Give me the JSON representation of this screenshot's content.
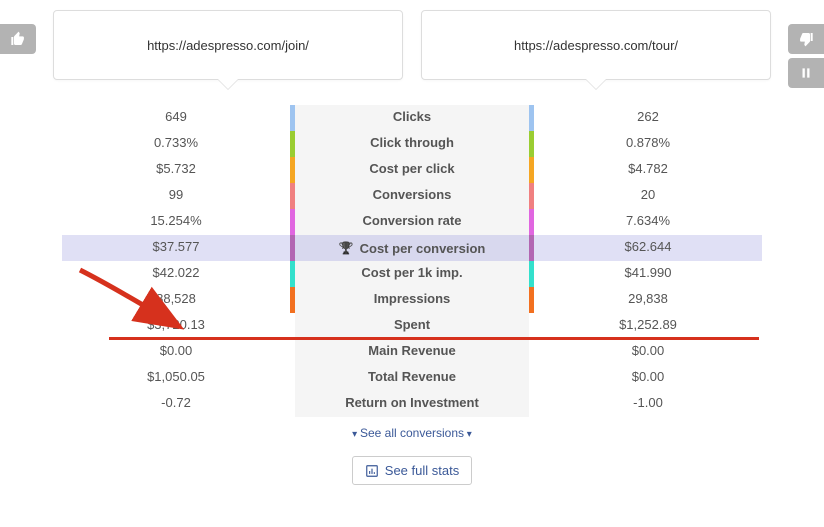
{
  "urls": {
    "left": "https://adespresso.com/join/",
    "right": "https://adespresso.com/tour/"
  },
  "rows": [
    {
      "label": "Clicks",
      "left": "649",
      "right": "262",
      "stripeL": "#9EC4F0",
      "stripeR": "#9EC4F0",
      "highlight": false
    },
    {
      "label": "Click through",
      "left": "0.733%",
      "right": "0.878%",
      "stripeL": "#9ACD32",
      "stripeR": "#9ACD32",
      "highlight": false
    },
    {
      "label": "Cost per click",
      "left": "$5.732",
      "right": "$4.782",
      "stripeL": "#F5A623",
      "stripeR": "#F5A623",
      "highlight": false
    },
    {
      "label": "Conversions",
      "left": "99",
      "right": "20",
      "stripeL": "#F08080",
      "stripeR": "#F08080",
      "highlight": false
    },
    {
      "label": "Conversion rate",
      "left": "15.254%",
      "right": "7.634%",
      "stripeL": "#E066E0",
      "stripeR": "#E066E0",
      "highlight": false
    },
    {
      "label": "Cost per conversion",
      "left": "$37.577",
      "right": "$62.644",
      "stripeL": "#B266B2",
      "stripeR": "#B266B2",
      "highlight": true,
      "icon": "trophy"
    },
    {
      "label": "Cost per 1k imp.",
      "left": "$42.022",
      "right": "$41.990",
      "stripeL": "#33E0CC",
      "stripeR": "#33E0CC",
      "highlight": false
    },
    {
      "label": "Impressions",
      "left": "88,528",
      "right": "29,838",
      "stripeL": "#F27020",
      "stripeR": "#F27020",
      "highlight": false
    },
    {
      "label": "Spent",
      "left": "$3,720.13",
      "right": "$1,252.89",
      "stripeL": "",
      "stripeR": "",
      "highlight": false
    },
    {
      "label": "Main Revenue",
      "left": "$0.00",
      "right": "$0.00",
      "stripeL": "",
      "stripeR": "",
      "highlight": false
    },
    {
      "label": "Total Revenue",
      "left": "$1,050.05",
      "right": "$0.00",
      "stripeL": "",
      "stripeR": "",
      "highlight": false
    },
    {
      "label": "Return on Investment",
      "left": "-0.72",
      "right": "-1.00",
      "stripeL": "",
      "stripeR": "",
      "highlight": false
    }
  ],
  "links": {
    "seeAll": "See all conversions",
    "fullStats": "See full stats"
  }
}
